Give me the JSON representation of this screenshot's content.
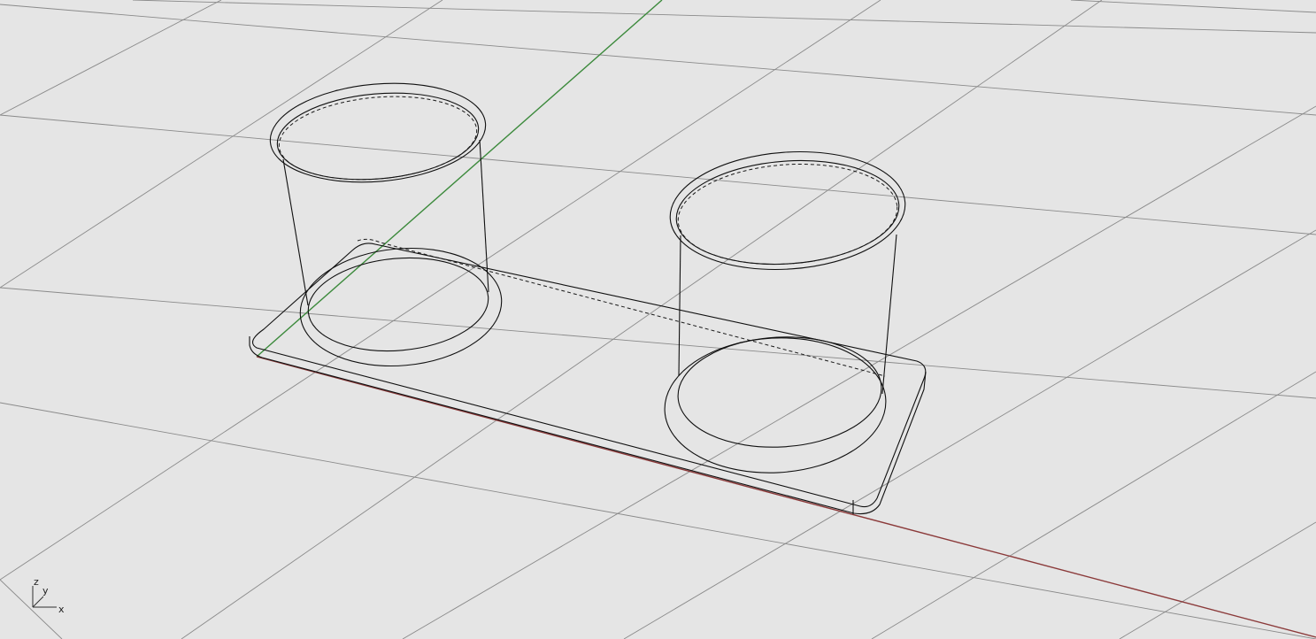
{
  "viewport": {
    "background_color": "#e5e5e5",
    "grid_color": "#8a8a8a",
    "wire_color": "#101010",
    "x_axis_color": "#8b3a3a",
    "y_axis_color": "#3c8a3c"
  },
  "axis_widget": {
    "z_label": "z",
    "y_label": "y",
    "x_label": "x"
  },
  "model": {
    "objects": [
      "base-plate",
      "cup-left",
      "cup-right"
    ]
  }
}
